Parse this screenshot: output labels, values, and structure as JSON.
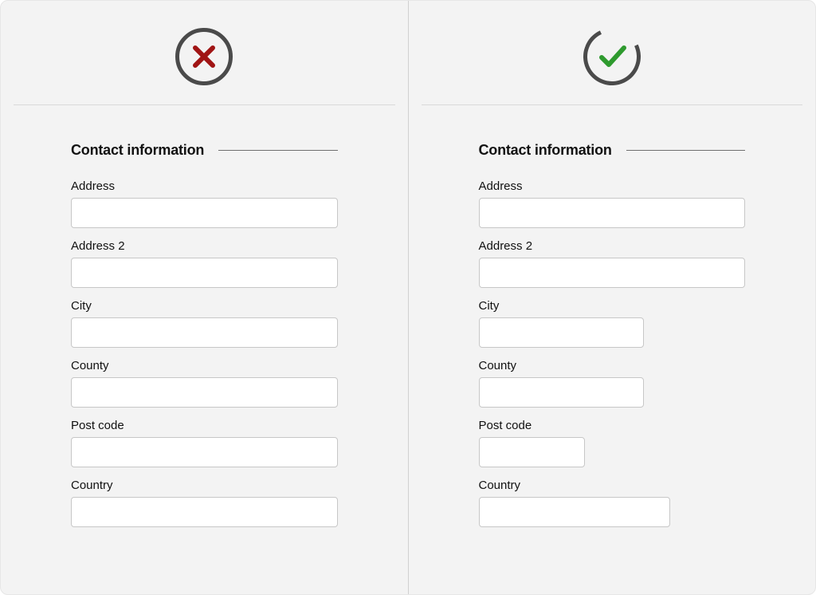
{
  "section_title": "Contact information",
  "labels": {
    "address": "Address",
    "address2": "Address 2",
    "city": "City",
    "county": "County",
    "postcode": "Post code",
    "country": "Country"
  }
}
